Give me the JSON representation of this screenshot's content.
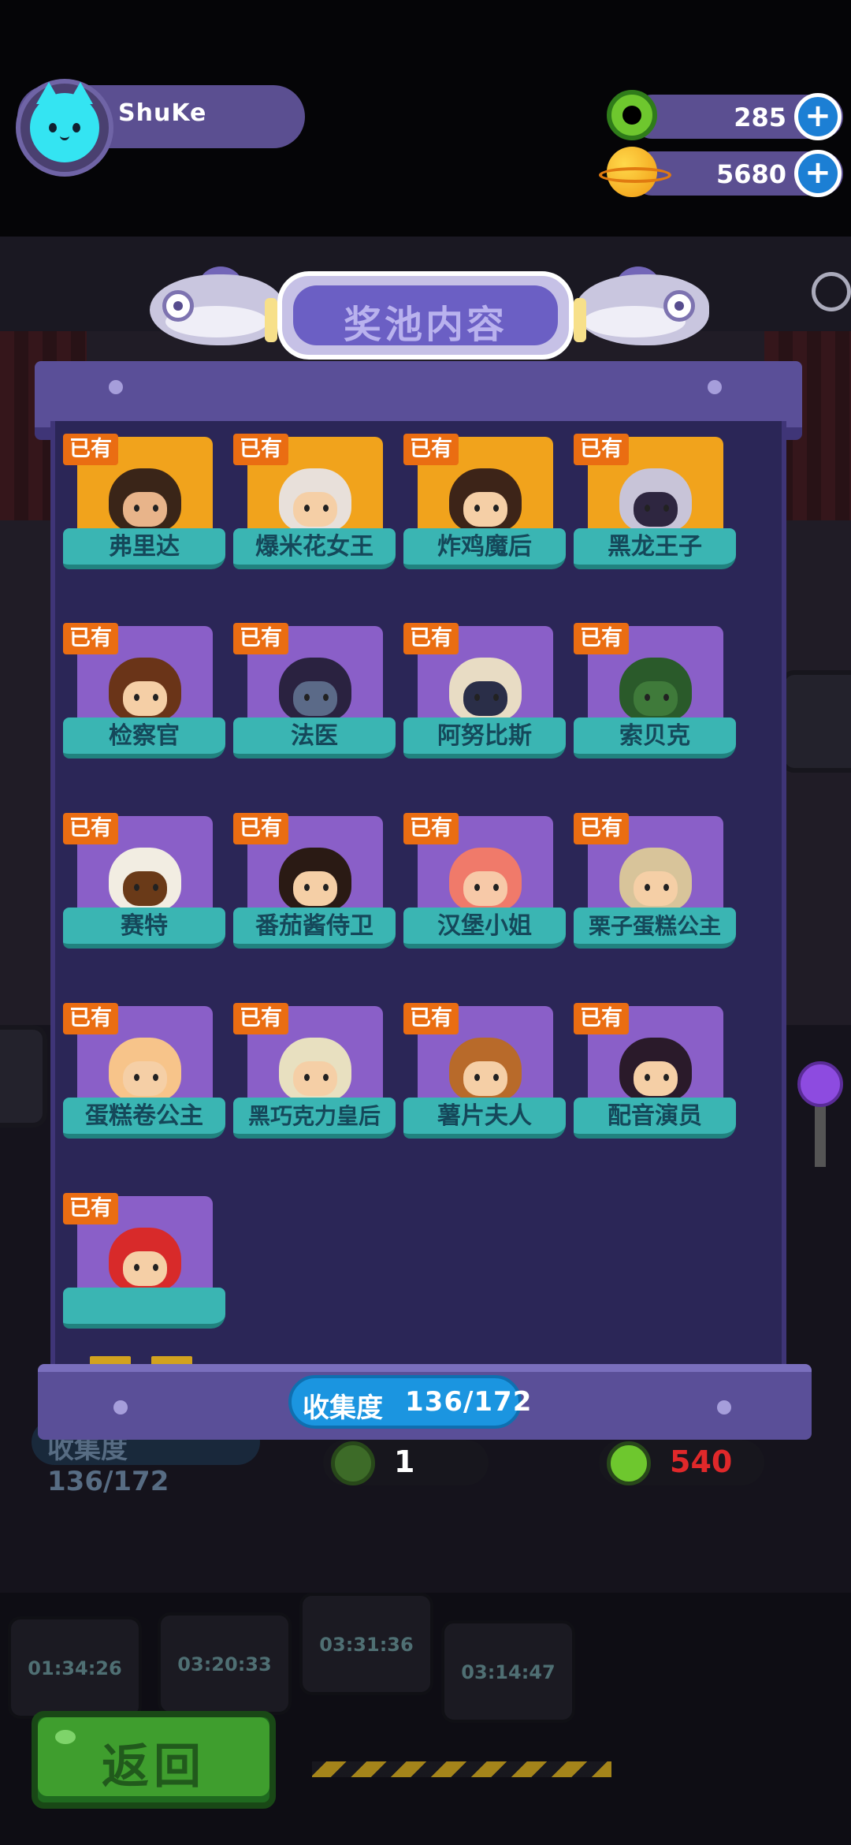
{
  "player": {
    "name": "ShuKe",
    "avatar_icon": "cat-icon"
  },
  "currencies": [
    {
      "icon": "green-ring-coin-icon",
      "amount": "285",
      "add_label": "+"
    },
    {
      "icon": "planet-coin-icon",
      "amount": "5680",
      "add_label": "+"
    }
  ],
  "dialog": {
    "title": "奖池内容",
    "collection_label": "收集度",
    "collection_value": "136/172",
    "collection_progress": 0.7907
  },
  "items": [
    {
      "name": "弗里达",
      "tag": "已有",
      "bg": "gold"
    },
    {
      "name": "爆米花女王",
      "tag": "已有",
      "bg": "gold"
    },
    {
      "name": "炸鸡魔后",
      "tag": "已有",
      "bg": "gold"
    },
    {
      "name": "黑龙王子",
      "tag": "已有",
      "bg": "gold"
    },
    {
      "name": "检察官",
      "tag": "已有",
      "bg": "purple"
    },
    {
      "name": "法医",
      "tag": "已有",
      "bg": "purple"
    },
    {
      "name": "阿努比斯",
      "tag": "已有",
      "bg": "purple"
    },
    {
      "name": "索贝克",
      "tag": "已有",
      "bg": "purple"
    },
    {
      "name": "赛特",
      "tag": "已有",
      "bg": "purple"
    },
    {
      "name": "番茄酱侍卫",
      "tag": "已有",
      "bg": "purple"
    },
    {
      "name": "汉堡小姐",
      "tag": "已有",
      "bg": "purple"
    },
    {
      "name": "栗子蛋糕公主",
      "tag": "已有",
      "bg": "purple"
    },
    {
      "name": "蛋糕卷公主",
      "tag": "已有",
      "bg": "purple"
    },
    {
      "name": "黑巧克力皇后",
      "tag": "已有",
      "bg": "purple"
    },
    {
      "name": "薯片夫人",
      "tag": "已有",
      "bg": "purple"
    },
    {
      "name": "配音演员",
      "tag": "已有",
      "bg": "purple"
    },
    {
      "name": "",
      "tag": "已有",
      "bg": "purple"
    }
  ],
  "background": {
    "collect_text": "收集度 136/172",
    "counter_left": "1",
    "counter_right": "540",
    "timers": [
      "01:34:26",
      "03:20:33",
      "03:31:36",
      "03:14:47"
    ]
  },
  "back_button": {
    "label": "返回"
  },
  "colors": {
    "panel": "#5a4f98",
    "panel_body": "#2b2657",
    "owned_tag": "#ea6d12",
    "name_banner": "#3ab5b3",
    "collection_badge": "#1b95e0",
    "back_button": "#3f9e2e"
  }
}
